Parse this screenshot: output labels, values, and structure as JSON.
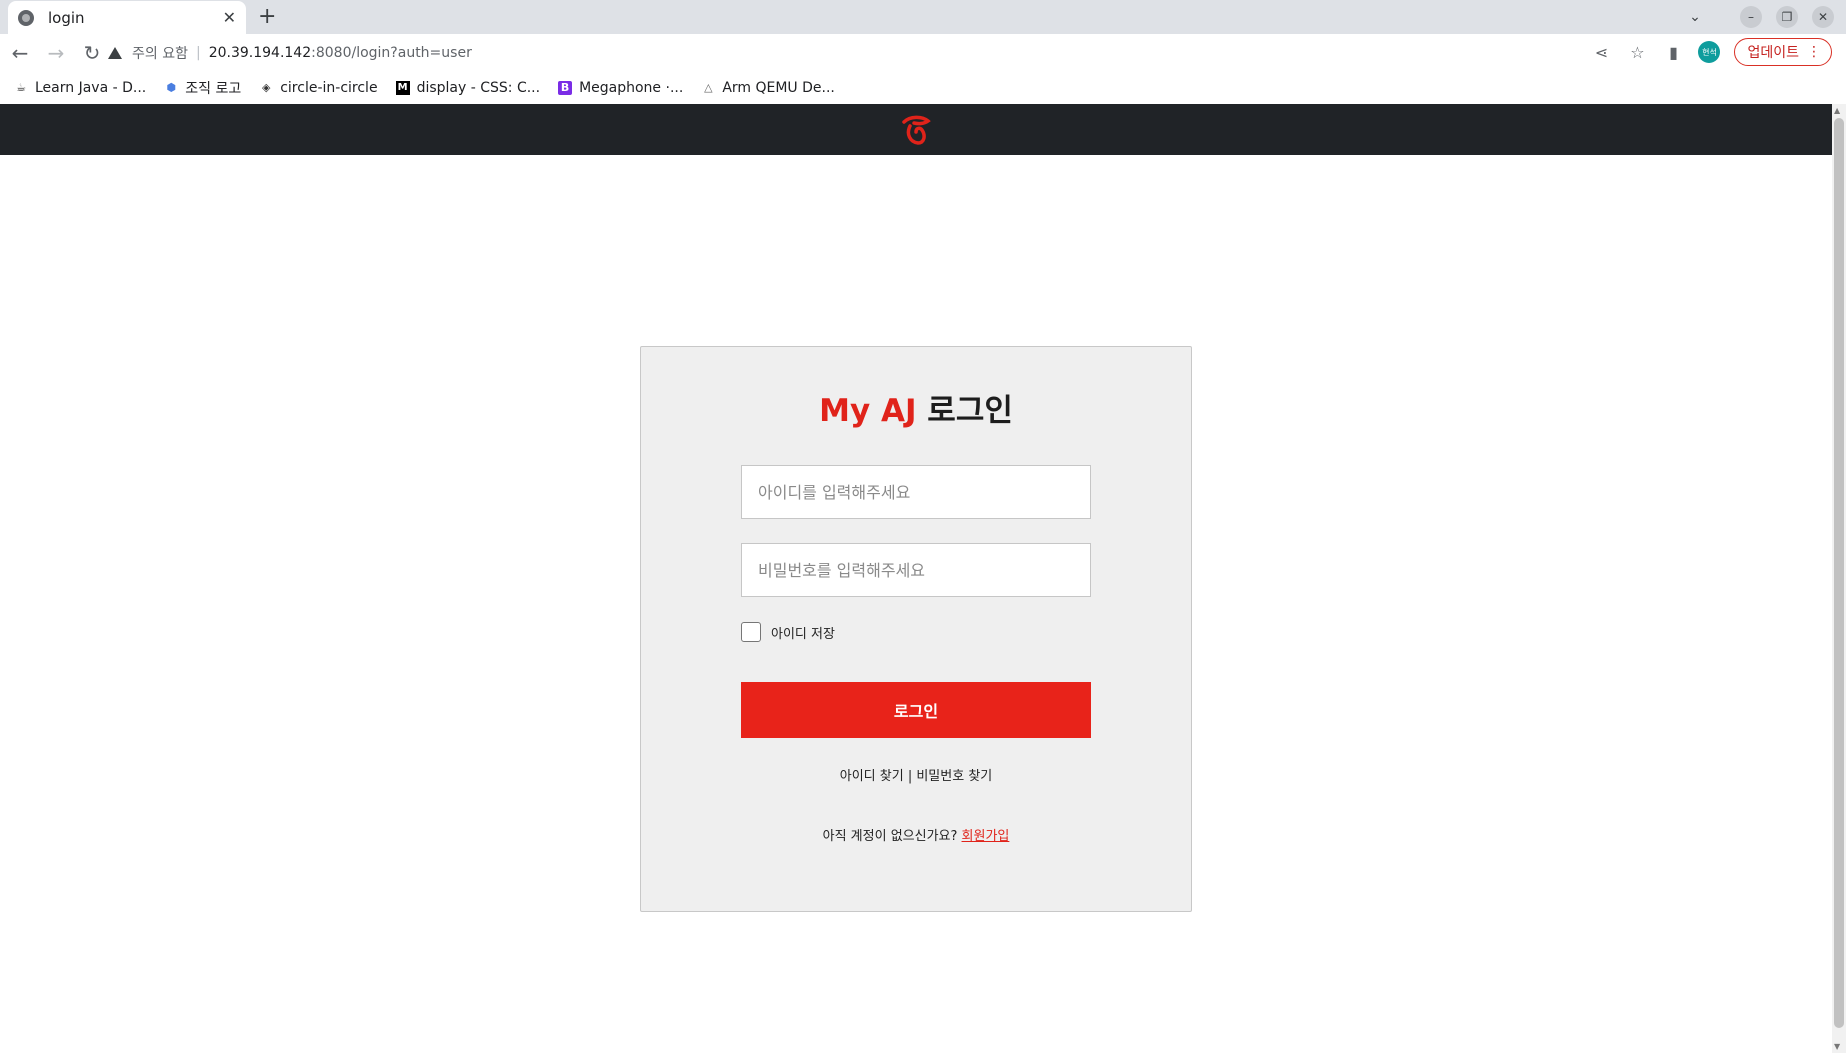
{
  "browser": {
    "tab_title": "login",
    "new_tab_symbol": "+",
    "address": {
      "security_label": "주의 요함",
      "host": "20.39.194.142",
      "rest": ":8080/login?auth=user"
    },
    "profile_initials": "현석",
    "update_label": "업데이트",
    "bookmarks": [
      {
        "label": "Learn Java - D...",
        "icon": "java-icon"
      },
      {
        "label": "조직 로고",
        "icon": "hexagon-icon"
      },
      {
        "label": "circle-in-circle",
        "icon": "codepen-icon"
      },
      {
        "label": "display - CSS: C...",
        "icon": "mdn-icon"
      },
      {
        "label": "Megaphone ·...",
        "icon": "bootstrap-icon"
      },
      {
        "label": "Arm QEMU De...",
        "icon": "penguin-icon"
      }
    ]
  },
  "login": {
    "title_brand": "My AJ",
    "title_rest": "로그인",
    "id_placeholder": "아이디를 입력해주세요",
    "pw_placeholder": "비밀번호를 입력해주세요",
    "remember_label": "아이디 저장",
    "submit_label": "로그인",
    "find_id": "아이디 찾기",
    "divider": "|",
    "find_pw": "비밀번호 찾기",
    "signup_prompt": "아직 계정이 없으신가요?",
    "signup_link": "회원가입"
  },
  "colors": {
    "brand_red": "#e8231a",
    "header_bg": "#202327",
    "card_bg": "#efefef"
  }
}
